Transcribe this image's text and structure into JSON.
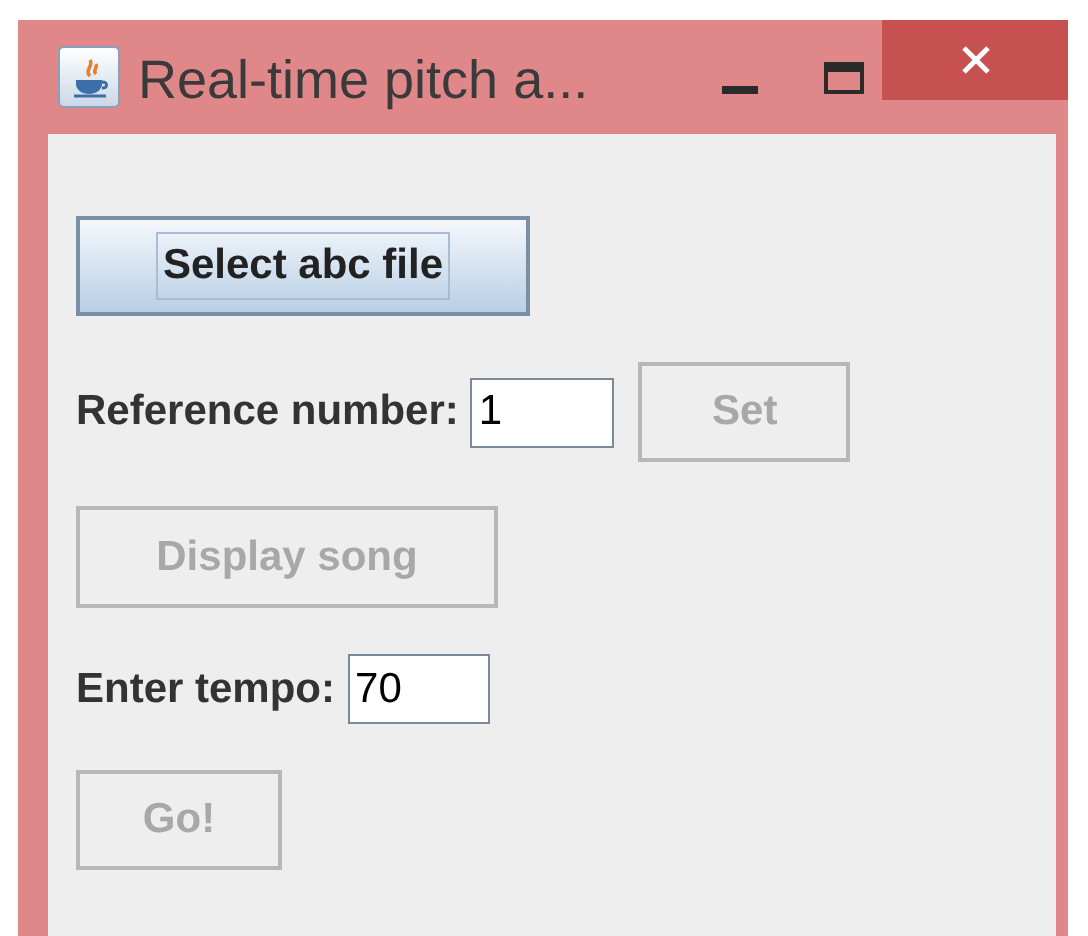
{
  "window": {
    "title": "Real-time pitch a..."
  },
  "select_button": {
    "label": "Select abc file",
    "disabled": false,
    "focused": true
  },
  "reference": {
    "label": "Reference number:",
    "value": "1"
  },
  "set_button": {
    "label": "Set",
    "disabled": true,
    "focused": false
  },
  "display_button": {
    "label": "Display song",
    "disabled": true,
    "focused": false
  },
  "tempo": {
    "label": "Enter tempo:",
    "value": "70"
  },
  "go_button": {
    "label": "Go!",
    "disabled": true,
    "focused": false
  }
}
